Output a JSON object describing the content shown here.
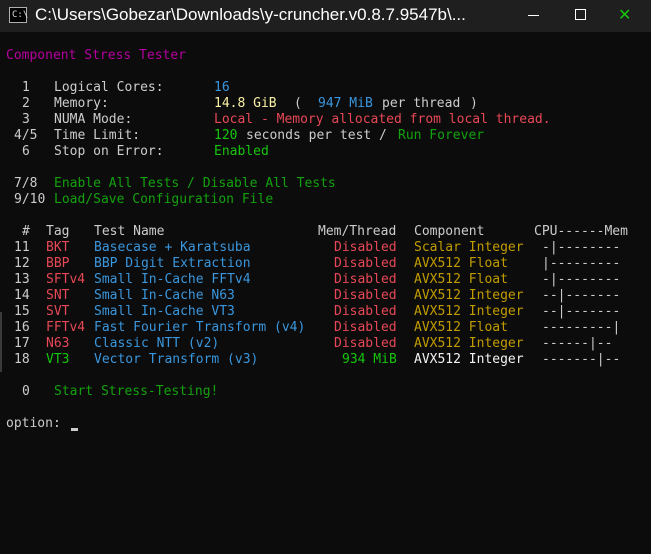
{
  "window": {
    "title": "C:\\Users\\Gobezar\\Downloads\\y-cruncher.v0.8.7.9547b\\...",
    "icon": "terminal-icon",
    "controls": {
      "minimize": "–",
      "maximize": "□",
      "close": "✕"
    }
  },
  "header": "Component Stress Tester",
  "settings": [
    {
      "key": "1",
      "label": "Logical Cores:",
      "value": "16"
    },
    {
      "key": "2",
      "label": "Memory:",
      "value": "14.8 GiB",
      "open": "(",
      "per_value": "947 MiB",
      "per_suffix": "per thread",
      "close": ")"
    },
    {
      "key": "3",
      "label": "NUMA Mode:",
      "value": "Local - Memory allocated from local thread."
    },
    {
      "key": "4/5",
      "label": "Time Limit:",
      "value": "120",
      "value_suffix": "seconds per test /",
      "alt": "Run Forever"
    },
    {
      "key": "6",
      "label": "Stop on Error:",
      "value": "Enabled"
    }
  ],
  "bulk_actions": {
    "key1": "7/8",
    "text1": "Enable All Tests / Disable All Tests",
    "key2": "9/10",
    "text2": "Load/Save Configuration File"
  },
  "table": {
    "headers": {
      "num": "#",
      "tag": "Tag",
      "name": "Test Name",
      "mem": "Mem/Thread",
      "component": "Component",
      "cpu_mem": "CPU------Mem"
    },
    "rows": [
      {
        "num": "11",
        "tag": "BKT",
        "name": "Basecase + Karatsuba",
        "mem": "Disabled",
        "component": "Scalar Integer",
        "bar": "-|--------",
        "enabled": false
      },
      {
        "num": "12",
        "tag": "BBP",
        "name": "BBP Digit Extraction",
        "mem": "Disabled",
        "component": "AVX512 Float",
        "bar": "|---------",
        "enabled": false
      },
      {
        "num": "13",
        "tag": "SFTv4",
        "name": "Small In-Cache FFTv4",
        "mem": "Disabled",
        "component": "AVX512 Float",
        "bar": "-|--------",
        "enabled": false
      },
      {
        "num": "14",
        "tag": "SNT",
        "name": "Small In-Cache N63",
        "mem": "Disabled",
        "component": "AVX512 Integer",
        "bar": "--|-------",
        "enabled": false
      },
      {
        "num": "15",
        "tag": "SVT",
        "name": "Small In-Cache VT3",
        "mem": "Disabled",
        "component": "AVX512 Integer",
        "bar": "--|-------",
        "enabled": false
      },
      {
        "num": "16",
        "tag": "FFTv4",
        "name": "Fast Fourier Transform (v4)",
        "mem": "Disabled",
        "component": "AVX512 Float",
        "bar": "---------|",
        "enabled": false
      },
      {
        "num": "17",
        "tag": "N63",
        "name": "Classic NTT (v2)",
        "mem": "Disabled",
        "component": "AVX512 Integer",
        "bar": "------|--",
        "enabled": false
      },
      {
        "num": "18",
        "tag": "VT3",
        "name": "Vector Transform (v3)",
        "mem": "934 MiB",
        "component": "AVX512 Integer",
        "bar": "-------|--",
        "enabled": true
      }
    ]
  },
  "start": {
    "key": "0",
    "label": "Start Stress-Testing!"
  },
  "prompt": "option:",
  "colors": {
    "background": "#0c0c0c",
    "titlebar": "#1f1f1f",
    "default_text": "#cccccc",
    "header": "#b4009e",
    "value": "#3a96dd",
    "memory": "#f9f1a5",
    "error": "#e74856",
    "enabled": "#16c60c",
    "component": "#c19c00"
  }
}
